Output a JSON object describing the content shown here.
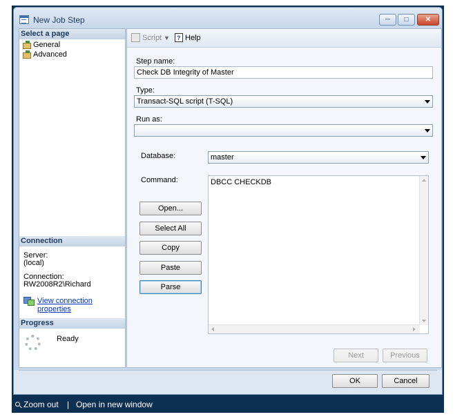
{
  "window": {
    "title": "New Job Step"
  },
  "left": {
    "select_page": "Select a page",
    "pages": [
      "General",
      "Advanced"
    ],
    "connection": {
      "header": "Connection",
      "server_label": "Server:",
      "server_value": "(local)",
      "connection_label": "Connection:",
      "connection_value": "RW2008R2\\Richard",
      "link": "View connection properties"
    },
    "progress": {
      "header": "Progress",
      "status": "Ready"
    }
  },
  "toolbar": {
    "script": "Script",
    "help": "Help"
  },
  "form": {
    "step_name_label": "Step name:",
    "step_name_value": "Check DB Integrity of Master",
    "type_label": "Type:",
    "type_value": "Transact-SQL script (T-SQL)",
    "run_as_label": "Run as:",
    "run_as_value": "",
    "database_label": "Database:",
    "database_value": "master",
    "command_label": "Command:",
    "command_value": "DBCC CHECKDB"
  },
  "buttons": {
    "open": "Open...",
    "select_all": "Select All",
    "copy": "Copy",
    "paste": "Paste",
    "parse": "Parse",
    "next": "Next",
    "previous": "Previous",
    "ok": "OK",
    "cancel": "Cancel"
  },
  "bottom_bar": {
    "zoom": "Zoom out",
    "separator": "|",
    "open_new": "Open in new window"
  },
  "colors": {
    "frame": "#0d2f52",
    "window": "#c9d9ec",
    "link": "#0033cc"
  }
}
